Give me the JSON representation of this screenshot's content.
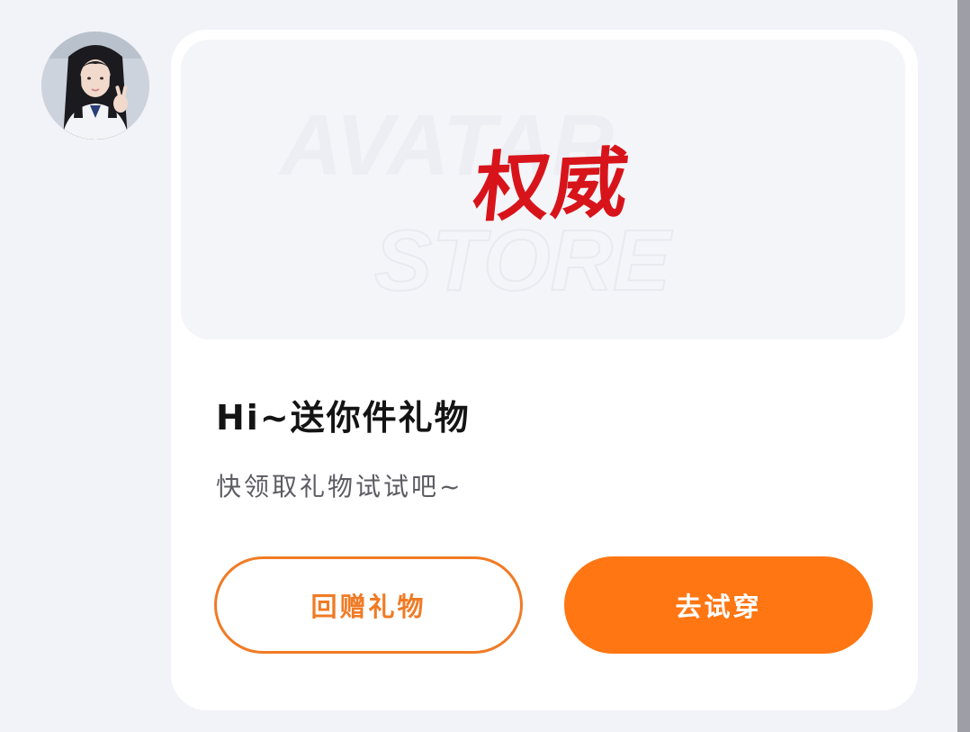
{
  "sender": {
    "avatar_alt": "sender avatar"
  },
  "gift_card": {
    "banner": {
      "watermark_line1": "AVATAR",
      "watermark_line2": "STORE",
      "gift_name": "权威",
      "gift_color": "#d8141b"
    },
    "title": "Hi~送你件礼物",
    "subtitle": "快领取礼物试试吧~",
    "actions": {
      "return_gift_label": "回赠礼物",
      "try_on_label": "去试穿"
    }
  },
  "colors": {
    "accent": "#ff7613",
    "page_background": "#f2f3f8",
    "card_background": "#ffffff"
  }
}
